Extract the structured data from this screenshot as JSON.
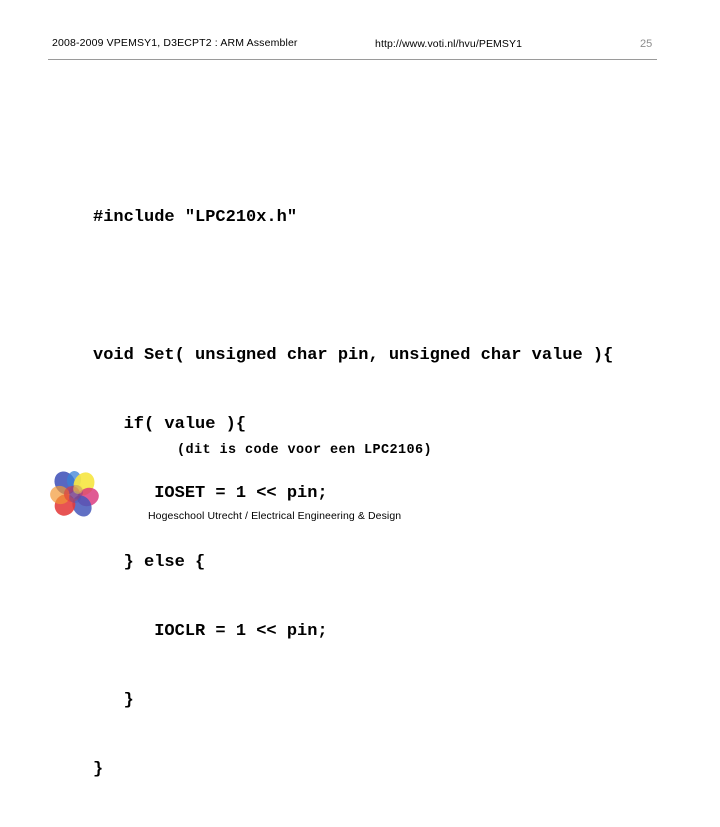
{
  "slide": {
    "header": {
      "course_title": "2008-2009 VPEMSY1, D3ECPT2 : ARM Assembler",
      "url": "http://www.voti.nl/hvu/PEMSY1",
      "page_number": "25",
      "rule_color": "#9a9a9a",
      "page_number_color": "#8d8d8d"
    },
    "code": {
      "language": "c",
      "lines": [
        "#include \"LPC210x.h\"",
        "",
        "void Set( unsigned char pin, unsigned char value ){",
        "   if( value ){",
        "      IOSET = 1 << pin;",
        "   } else {",
        "      IOCLR = 1 << pin;",
        "   }",
        "}"
      ]
    },
    "caption": "(dit is code voor een LPC2106)",
    "footer": {
      "text": "Hogeschool Utrecht / Electrical Engineering & Design",
      "logo_name": "hogeschool-utrecht-pinwheel-logo",
      "logo_colors": {
        "blue": "#2b3fb0",
        "cyan_blue": "#1f6fd0",
        "yellow": "#f5e32a",
        "orange": "#f08a1a",
        "red": "#e02020",
        "magenta": "#d41a6a",
        "purple": "#7b1f7a",
        "green": "#3aa83a"
      }
    }
  }
}
